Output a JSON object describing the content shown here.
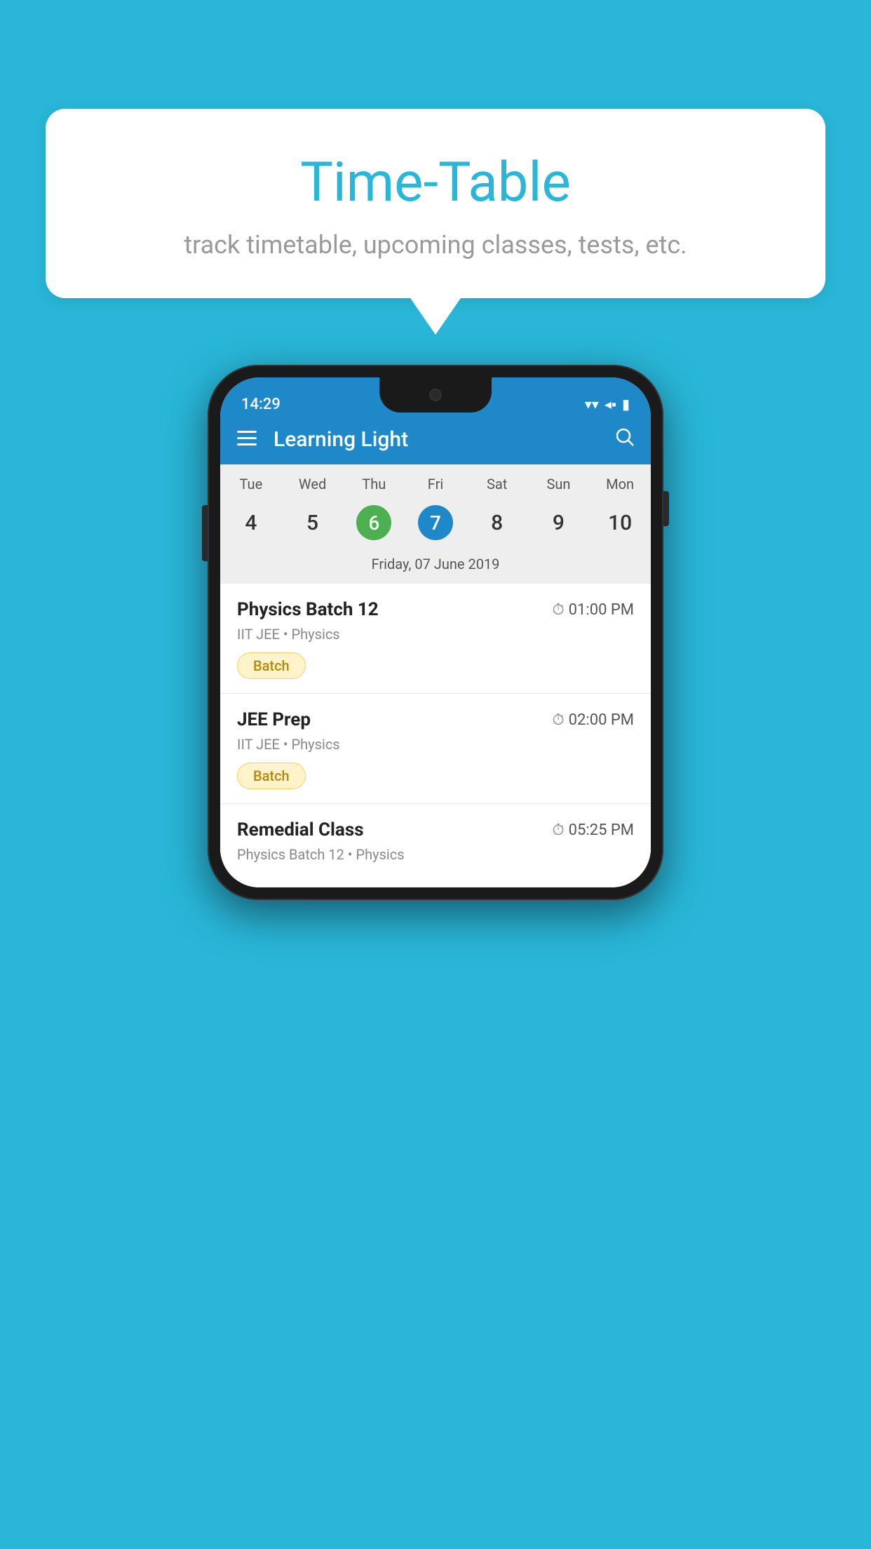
{
  "background": {
    "color": "#29B6D8"
  },
  "speech_bubble": {
    "title": "Time-Table",
    "subtitle": "track timetable, upcoming classes, tests, etc."
  },
  "phone": {
    "status_bar": {
      "time": "14:29",
      "wifi_icon": "▼",
      "signal_icon": "▲",
      "battery_icon": "▮"
    },
    "toolbar": {
      "title": "Learning Light",
      "hamburger_label": "☰",
      "search_label": "🔍"
    },
    "calendar": {
      "day_names": [
        "Tue",
        "Wed",
        "Thu",
        "Fri",
        "Sat",
        "Sun",
        "Mon"
      ],
      "day_numbers": [
        "4",
        "5",
        "6",
        "7",
        "8",
        "9",
        "10"
      ],
      "today_index": 2,
      "selected_index": 3,
      "selected_date_label": "Friday, 07 June 2019"
    },
    "schedule_items": [
      {
        "title": "Physics Batch 12",
        "time": "01:00 PM",
        "subtitle": "IIT JEE • Physics",
        "badge": "Batch"
      },
      {
        "title": "JEE Prep",
        "time": "02:00 PM",
        "subtitle": "IIT JEE • Physics",
        "badge": "Batch"
      },
      {
        "title": "Remedial Class",
        "time": "05:25 PM",
        "subtitle": "Physics Batch 12 • Physics",
        "badge": null
      }
    ]
  }
}
